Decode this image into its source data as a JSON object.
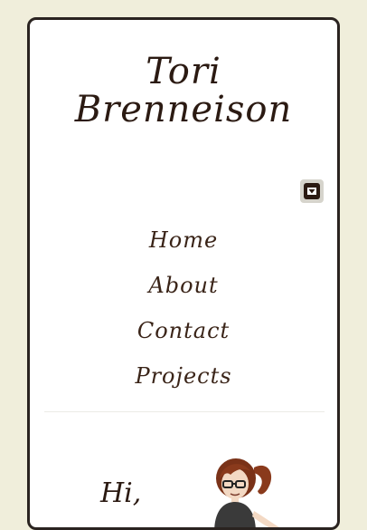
{
  "site": {
    "title_line1": "Tori",
    "title_line2": "Brenneison"
  },
  "nav": {
    "items": [
      {
        "label": "Home"
      },
      {
        "label": "About"
      },
      {
        "label": "Contact"
      },
      {
        "label": "Projects"
      }
    ]
  },
  "intro": {
    "greeting": "Hi,"
  },
  "icons": {
    "menu_toggle": "caret-down-icon",
    "avatar": "cartoon-avatar"
  },
  "colors": {
    "page_background": "#f0eedb",
    "card_background": "#ffffff",
    "text_brown": "#2b1a12"
  }
}
